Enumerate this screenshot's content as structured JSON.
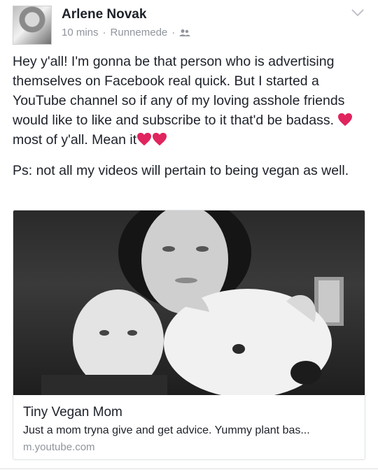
{
  "post": {
    "author": "Arlene Novak",
    "time": "10 mins",
    "location": "Runnemede",
    "audience_icon": "friends-icon",
    "paragraph1_a": "Hey y'all! I'm gonna be that person who is advertising themselves on Facebook real quick. But I started a YouTube channel so if any of my loving asshole friends would like to like and subscribe to it that'd be badass.",
    "paragraph1_b": " most of y'all. Mean it",
    "paragraph2": "Ps: not all my videos will pertain to being vegan as well."
  },
  "link_card": {
    "title": "Tiny Vegan Mom",
    "description": "Just a mom tryna give and get advice. Yummy plant bas...",
    "domain": "m.youtube.com"
  },
  "colors": {
    "text": "#1d2129",
    "meta": "#90949c",
    "heart": "#e0245e"
  }
}
